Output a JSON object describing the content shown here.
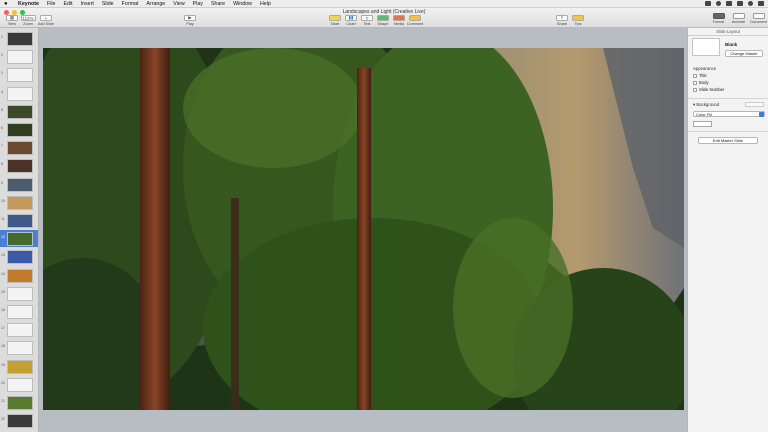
{
  "menubar": {
    "app_name": "Keynote",
    "items": [
      "File",
      "Edit",
      "Insert",
      "Slide",
      "Format",
      "Arrange",
      "View",
      "Play",
      "Share",
      "Window",
      "Help"
    ]
  },
  "window": {
    "title": "Landscapes and Light (Creative Live)"
  },
  "toolbar": {
    "view_label": "View",
    "zoom_value": "112%",
    "zoom_label": "Zoom",
    "add_slide_label": "Add Slide",
    "play_label": "Play",
    "table_label": "Table",
    "chart_label": "Chart",
    "text_label": "Text",
    "shape_label": "Shape",
    "media_label": "Media",
    "comment_label": "Comment",
    "share_label": "Share",
    "tips_label": "Tips"
  },
  "navigator": {
    "slide_numbers": [
      "1",
      "2",
      "3",
      "4",
      "5",
      "6",
      "7",
      "8",
      "9",
      "10",
      "11",
      "12",
      "13",
      "14",
      "15",
      "16",
      "17",
      "18",
      "19",
      "20",
      "21",
      "22"
    ],
    "selected_index": 11
  },
  "inspector": {
    "tabs": [
      "Format",
      "Animate",
      "Document"
    ],
    "active_tab": "Format",
    "header": "Slide Layout",
    "master_name": "Blank",
    "change_master_label": "Change Master",
    "appearance_label": "Appearance",
    "checkboxes": [
      "Title",
      "Body",
      "Slide Number"
    ],
    "background_label": "Background",
    "fill_type": "Color Fill",
    "edit_master_label": "Edit Master Slide"
  },
  "colors": {
    "selection_accent": "#4a7fd6",
    "inspector_bg": "#f3f3f3",
    "navigator_bg": "#dcdcdc",
    "canvas_bg": "#b8bcc3"
  }
}
